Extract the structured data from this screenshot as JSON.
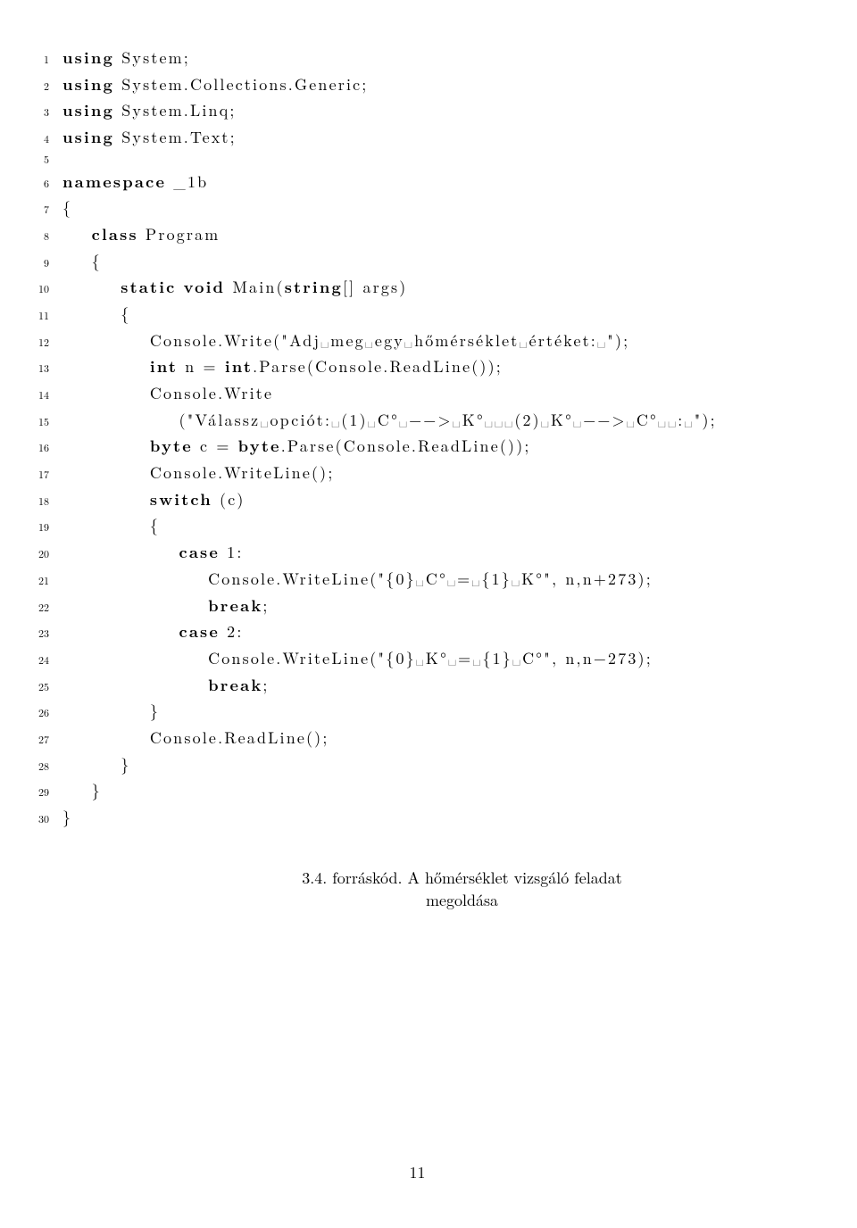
{
  "lines": [
    {
      "n": "1",
      "ind": 0,
      "parts": [
        {
          "t": "using",
          "k": true
        },
        {
          "t": " System;"
        }
      ]
    },
    {
      "n": "2",
      "ind": 0,
      "parts": [
        {
          "t": "using",
          "k": true
        },
        {
          "t": " System.Collections.Generic;"
        }
      ]
    },
    {
      "n": "3",
      "ind": 0,
      "parts": [
        {
          "t": "using",
          "k": true
        },
        {
          "t": " System.Linq;"
        }
      ]
    },
    {
      "n": "4",
      "ind": 0,
      "parts": [
        {
          "t": "using",
          "k": true
        },
        {
          "t": " System.Text;"
        }
      ]
    },
    {
      "n": "5",
      "ind": 0,
      "parts": []
    },
    {
      "n": "6",
      "ind": 0,
      "parts": [
        {
          "t": "namespace",
          "k": true
        },
        {
          "t": " _1b"
        }
      ]
    },
    {
      "n": "7",
      "ind": 0,
      "parts": [
        {
          "t": "{"
        }
      ]
    },
    {
      "n": "8",
      "ind": 1,
      "parts": [
        {
          "t": "class",
          "k": true
        },
        {
          "t": " Program"
        }
      ]
    },
    {
      "n": "9",
      "ind": 1,
      "parts": [
        {
          "t": "{"
        }
      ]
    },
    {
      "n": "10",
      "ind": 2,
      "parts": [
        {
          "t": "static",
          "k": true
        },
        {
          "t": " "
        },
        {
          "t": "void",
          "k": true
        },
        {
          "t": " Main("
        },
        {
          "t": "string",
          "k": true
        },
        {
          "t": "[] args)"
        }
      ]
    },
    {
      "n": "11",
      "ind": 2,
      "parts": [
        {
          "t": "{"
        }
      ]
    },
    {
      "n": "12",
      "ind": 3,
      "parts": [
        {
          "t": "Console.Write(\"Adj␣meg␣egy␣hőmérséklet␣értéket:␣\");"
        }
      ]
    },
    {
      "n": "13",
      "ind": 3,
      "parts": [
        {
          "t": "int",
          "k": true
        },
        {
          "t": " n = "
        },
        {
          "t": "int",
          "k": true
        },
        {
          "t": ".Parse(Console.ReadLine());"
        }
      ]
    },
    {
      "n": "14",
      "ind": 3,
      "parts": [
        {
          "t": "Console.Write"
        }
      ]
    },
    {
      "n": "15",
      "ind": 4,
      "parts": [
        {
          "t": "(\"Válassz␣opciót:␣(1)␣C°␣−−>␣K°␣␣␣(2)␣K°␣−−>␣C°␣␣:␣\");"
        }
      ]
    },
    {
      "n": "16",
      "ind": 3,
      "parts": [
        {
          "t": "byte",
          "k": true
        },
        {
          "t": " c = "
        },
        {
          "t": "byte",
          "k": true
        },
        {
          "t": ".Parse(Console.ReadLine());"
        }
      ]
    },
    {
      "n": "17",
      "ind": 3,
      "parts": [
        {
          "t": "Console.WriteLine();"
        }
      ]
    },
    {
      "n": "18",
      "ind": 3,
      "parts": [
        {
          "t": "switch",
          "k": true
        },
        {
          "t": " (c)"
        }
      ]
    },
    {
      "n": "19",
      "ind": 3,
      "parts": [
        {
          "t": "{"
        }
      ]
    },
    {
      "n": "20",
      "ind": 4,
      "parts": [
        {
          "t": "case",
          "k": true
        },
        {
          "t": " 1:"
        }
      ]
    },
    {
      "n": "21",
      "ind": 5,
      "parts": [
        {
          "t": "Console.WriteLine(\"{0}␣C°␣=␣{1}␣K°\", n,n+273);"
        }
      ]
    },
    {
      "n": "22",
      "ind": 5,
      "parts": [
        {
          "t": "break",
          "k": true
        },
        {
          "t": ";"
        }
      ]
    },
    {
      "n": "23",
      "ind": 4,
      "parts": [
        {
          "t": "case",
          "k": true
        },
        {
          "t": " 2:"
        }
      ]
    },
    {
      "n": "24",
      "ind": 5,
      "parts": [
        {
          "t": "Console.WriteLine(\"{0}␣K°␣=␣{1}␣C°\", n,n−273);"
        }
      ]
    },
    {
      "n": "25",
      "ind": 5,
      "parts": [
        {
          "t": "break",
          "k": true
        },
        {
          "t": ";"
        }
      ]
    },
    {
      "n": "26",
      "ind": 3,
      "parts": [
        {
          "t": "}"
        }
      ]
    },
    {
      "n": "27",
      "ind": 3,
      "parts": [
        {
          "t": "Console.ReadLine();"
        }
      ]
    },
    {
      "n": "28",
      "ind": 2,
      "parts": [
        {
          "t": "}"
        }
      ]
    },
    {
      "n": "29",
      "ind": 1,
      "parts": [
        {
          "t": "}"
        }
      ]
    },
    {
      "n": "30",
      "ind": 0,
      "parts": [
        {
          "t": "}"
        }
      ]
    }
  ],
  "caption": "3.4. forráskód. A hőmérséklet vizsgáló feladat megoldása",
  "page_number": "11"
}
